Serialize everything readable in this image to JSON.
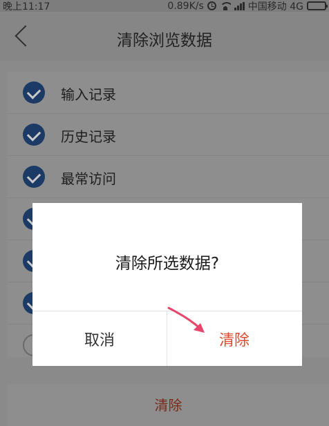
{
  "status_bar": {
    "time": "晚上11:17",
    "network_speed": "0.89K/s",
    "carrier": "中国移动 4G"
  },
  "header": {
    "title": "清除浏览数据"
  },
  "options": [
    {
      "label": "输入记录",
      "checked": true
    },
    {
      "label": "历史记录",
      "checked": true
    },
    {
      "label": "最常访问",
      "checked": true
    },
    {
      "label": "",
      "checked": true
    },
    {
      "label": "",
      "checked": true
    },
    {
      "label": "",
      "checked": true
    },
    {
      "label": "",
      "checked": false
    }
  ],
  "bottom_button": {
    "label": "清除"
  },
  "dialog": {
    "message": "清除所选数据?",
    "cancel_label": "取消",
    "confirm_label": "清除"
  },
  "colors": {
    "accent_blue": "#2b73d6",
    "danger_red": "#e0492d",
    "overlay": "#8a8a8a"
  }
}
